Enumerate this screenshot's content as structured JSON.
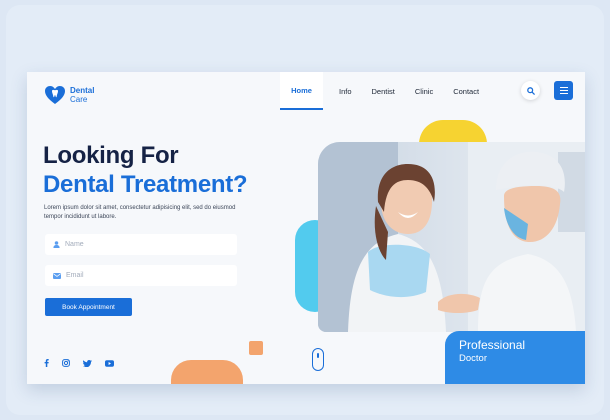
{
  "brand": {
    "line1": "Dental",
    "line2": "Care",
    "color": "#1a6ed8"
  },
  "nav": {
    "items": [
      {
        "label": "Home",
        "active": true
      },
      {
        "label": "Info",
        "active": false
      },
      {
        "label": "Dentist",
        "active": false
      },
      {
        "label": "Clinic",
        "active": false
      },
      {
        "label": "Contact",
        "active": false
      }
    ],
    "search_icon": "search-icon",
    "menu_icon": "hamburger-menu-icon"
  },
  "hero": {
    "title_line1": "Looking For",
    "title_line2": "Dental Treatment?",
    "description": "Lorem ipsum dolor sit amet, consectetur adipisicing elit, sed do eiusmod tempor incididunt ut labore."
  },
  "form": {
    "name_placeholder": "Name",
    "email_placeholder": "Email",
    "name_icon": "user-icon",
    "email_icon": "mail-icon",
    "submit_label": "Book Appointment"
  },
  "socials": [
    "facebook-icon",
    "instagram-icon",
    "twitter-icon",
    "youtube-icon"
  ],
  "badge": {
    "line1": "Professional",
    "line2": "Doctor"
  },
  "colors": {
    "primary": "#1a6ed8",
    "navy": "#152245",
    "yellow": "#f6d331",
    "cyan": "#52cbee",
    "orange": "#f3a46d",
    "badge": "#2e8be6"
  }
}
